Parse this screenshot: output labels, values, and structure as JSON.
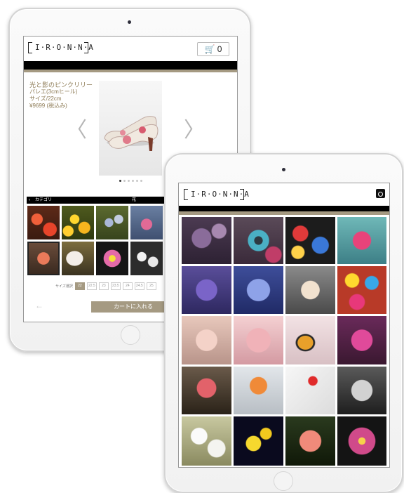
{
  "back_tablet": {
    "logo": "I·R·O·N·N·A",
    "cart_icon": "cart-icon",
    "cart_count": "0",
    "product": {
      "title": "光と影のピンクリリー",
      "type": "パレエ(3cmヒール)",
      "size": "サイズ/22cm",
      "price": "¥9699 (税込み)"
    },
    "gallery_dots": 6,
    "gallery_active_dot": 0,
    "category_label": "カテゴリ",
    "category_right": "花",
    "size_label": "サイズ選択",
    "sizes": [
      "22",
      "22.5",
      "23",
      "23.5",
      "24",
      "24.5",
      "25"
    ],
    "selected_size": "22",
    "add_to_cart": "カートに入れる",
    "colors": {
      "accent": "#a59a82",
      "text_accent": "#8d7b55",
      "bar": "#000000"
    }
  },
  "front_tablet": {
    "logo": "I·R·O·N·N·A",
    "instagram_icon": "instagram-icon",
    "photo_grid_rows": 5,
    "photo_grid_cols": 4
  }
}
